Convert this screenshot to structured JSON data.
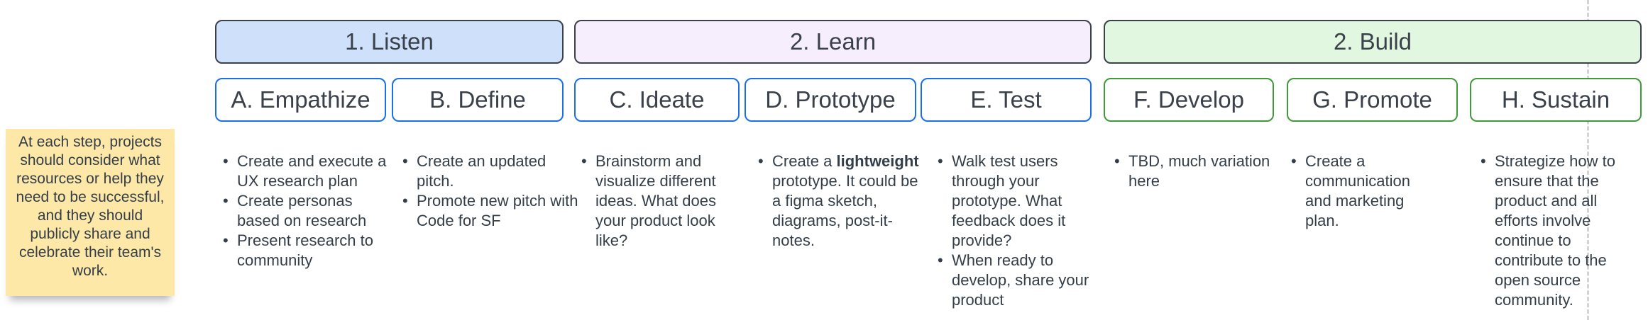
{
  "phases": {
    "listen": "1. Listen",
    "learn": "2. Learn",
    "build": "2. Build"
  },
  "steps": {
    "empathize": "A. Empathize",
    "define": "B. Define",
    "ideate": "C. Ideate",
    "prototype": "D. Prototype",
    "test": "E. Test",
    "develop": "F. Develop",
    "promote": "G. Promote",
    "sustain": "H. Sustain"
  },
  "bullets": {
    "empathize": [
      "Create and execute a UX research plan",
      "Create personas based on research",
      "Present research to community"
    ],
    "define": [
      "Create an updated pitch.",
      "Promote new pitch with Code for SF"
    ],
    "ideate": [
      "Brainstorm and visualize different ideas. What does your product look like?"
    ],
    "prototype": {
      "before": "Create a",
      "bold": "lightweight",
      "after": "prototype. It could be a figma sketch, diagrams, post-it-notes."
    },
    "test": [
      "Walk test users through your prototype. What feedback does it provide?",
      "When ready to develop, share your product"
    ],
    "develop": [
      "TBD, much variation here"
    ],
    "promote": [
      "Create a communication and marketing plan."
    ],
    "sustain": [
      "Strategize how to ensure that the product and all efforts involve continue to contribute to the open source community."
    ]
  },
  "sticky_note": "At each step, projects should consider what resources or help they need to be successful, and they should publicly share and celebrate their team's work.",
  "colors": {
    "listen_fill": "#cfe0fa",
    "learn_fill": "#f6eefc",
    "build_fill": "#e2f7df",
    "blue_border": "#1a6fe6",
    "green_border": "#3f9a38",
    "sticky_fill": "#fde8a8"
  }
}
